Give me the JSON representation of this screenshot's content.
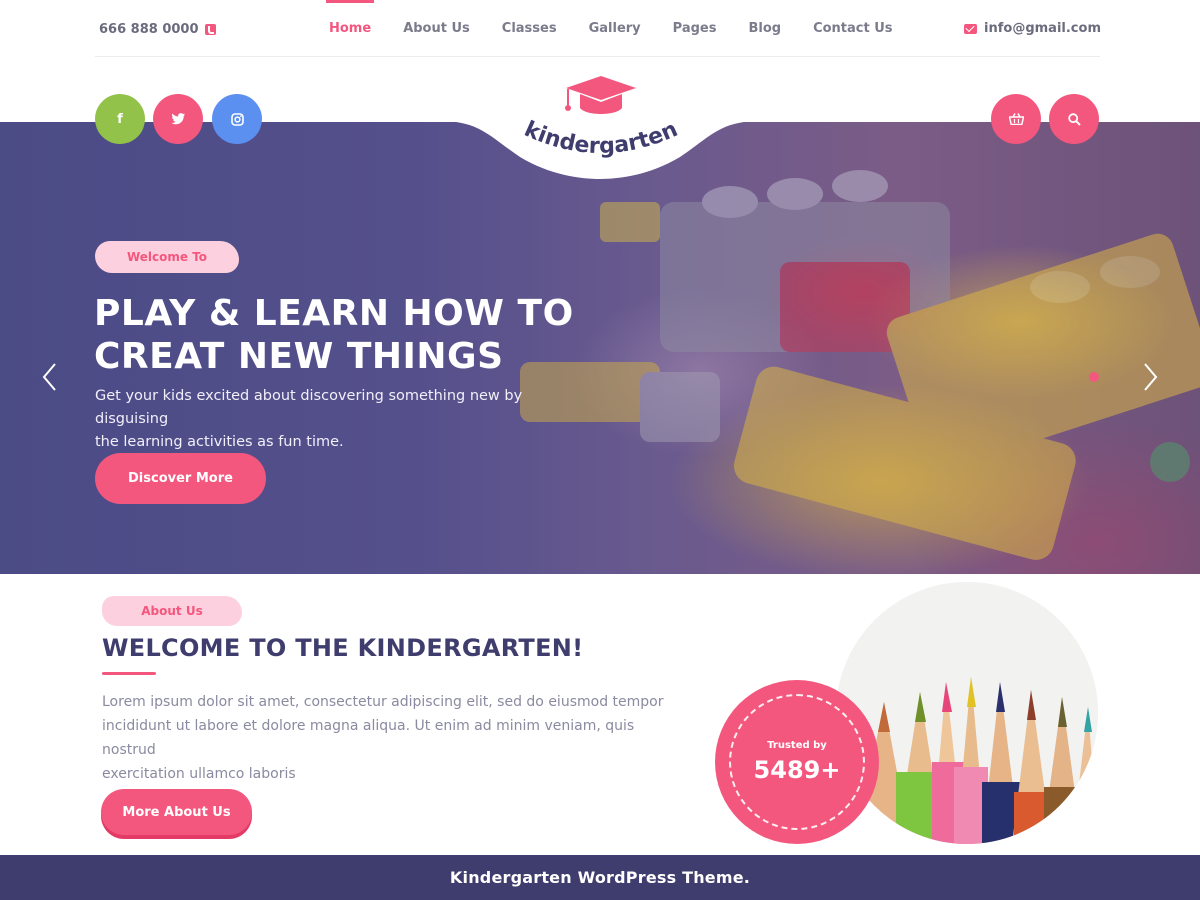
{
  "topbar": {
    "phone": "666 888 0000",
    "email": "info@gmail.com"
  },
  "nav": {
    "items": [
      {
        "label": "Home",
        "active": true
      },
      {
        "label": "About Us"
      },
      {
        "label": "Classes"
      },
      {
        "label": "Gallery"
      },
      {
        "label": "Pages"
      },
      {
        "label": "Blog"
      },
      {
        "label": "Contact Us"
      }
    ]
  },
  "logo": {
    "text": "kindergarten"
  },
  "social": {
    "facebook": "f",
    "twitter": "twitter-icon",
    "instagram": "instagram-icon"
  },
  "hero": {
    "badge": "Welcome To",
    "title_line1": "PLAY & LEARN HOW TO",
    "title_line2": "CREAT NEW THINGS",
    "description_line1": "Get your kids excited about discovering something new by disguising",
    "description_line2": "the learning activities as fun time.",
    "button": "Discover More"
  },
  "about": {
    "badge": "About Us",
    "title": "WELCOME TO THE KINDERGARTEN!",
    "text_line1": "Lorem ipsum dolor sit amet, consectetur adipiscing elit, sed do eiusmod tempor",
    "text_line2": "incididunt ut labore et dolore magna aliqua. Ut enim ad minim veniam, quis nostrud",
    "text_line3": "exercitation ullamco laboris",
    "button": "More About Us",
    "trusted_label": "Trusted by",
    "trusted_count": "5489+"
  },
  "footer": {
    "text": "Kindergarten WordPress Theme."
  },
  "colors": {
    "accent": "#f4577e",
    "navy": "#3e3d6d",
    "facebook": "#93c24a",
    "instagram": "#5b8ff0"
  }
}
